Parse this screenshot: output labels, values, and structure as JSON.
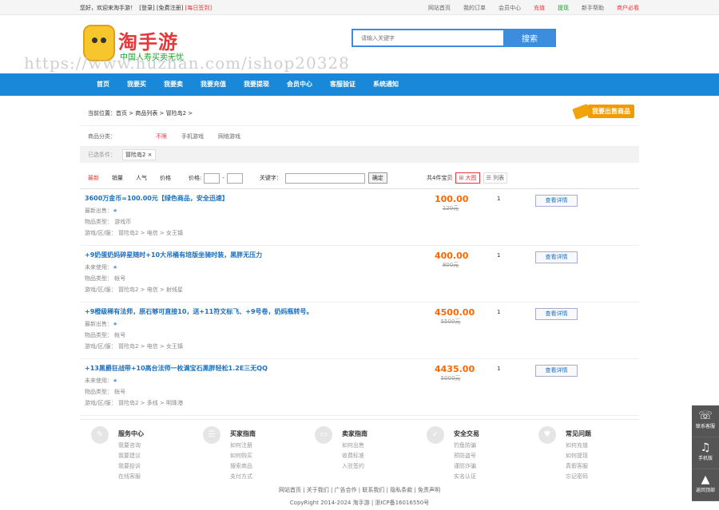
{
  "topbar": {
    "greeting": "您好，欢迎来淘手游！",
    "login": "[登录]",
    "register": "[免费注册]",
    "checkin": "[每日签到]",
    "links": [
      {
        "label": "网站首页",
        "color": "#666"
      },
      {
        "label": "我的订单",
        "color": "#666"
      },
      {
        "label": "会员中心",
        "color": "#666"
      },
      {
        "label": "充值",
        "color": "#e4393c"
      },
      {
        "label": "提现",
        "color": "#1a9f29"
      },
      {
        "label": "新手帮助",
        "color": "#666"
      },
      {
        "label": "商户必看",
        "color": "#e4393c"
      }
    ]
  },
  "logo": {
    "title": "淘手游",
    "sub": "中国人寿买卖无忧"
  },
  "search": {
    "placeholder": "请输入关键字",
    "button": "搜索"
  },
  "watermark": "https://www.huzhan.com/ishop20328",
  "nav": [
    "首页",
    "我要买",
    "我要卖",
    "我要充值",
    "我要提现",
    "会员中心",
    "客服验证",
    "系统通知"
  ],
  "crumb": {
    "text": "当前位置：首页 > 商品列表 > 冒险岛2 >",
    "sell": "我要出售商品"
  },
  "cats": {
    "label": "商品分类：",
    "items": [
      "不限",
      "手机游戏",
      "网络游戏"
    ]
  },
  "filter": {
    "label": "已选条件：",
    "tag": "冒险岛2 ×"
  },
  "sort": {
    "items": [
      "最新",
      "销量",
      "人气",
      "价格"
    ],
    "price_label": "价格:",
    "dash": "-",
    "kw_label": "关键字：",
    "ok": "确定",
    "pages": "共4件宝贝",
    "mode_big": "⊞ 大图",
    "mode_list": "☰ 列表"
  },
  "items": [
    {
      "title": "3600万金币=100.00元【绿色商品，安全迅速】",
      "r1": "最新出售：",
      "r2": "物品类型：   游戏币",
      "r3": "游戏/区/服：  冒险岛2 > 电信 > 女王镇",
      "price": "100.00",
      "old": "120元",
      "qty": "1",
      "btn": "查看详情"
    },
    {
      "title": "+9奶蛋奶妈碎星随时+10大吊桶有培版坐骑时装，黑胖无压力",
      "r1": "未来使用：",
      "r2": "物品类型：   帐号",
      "r3": "游戏/区/服：  冒险岛2 > 电信 > 射线星",
      "price": "400.00",
      "old": "800元",
      "qty": "1",
      "btn": "查看详情"
    },
    {
      "title": "+9橙级稀有法师，原石够可直接10，送+11符文标飞、+9号卷，奶妈瓶转号。",
      "r1": "最新出售：",
      "r2": "物品类型：   帐号",
      "r3": "游戏/区/服：  冒险岛2 > 电信 > 女王镇",
      "price": "4500.00",
      "old": "5500元",
      "qty": "1",
      "btn": "查看详情"
    },
    {
      "title": "+13黑爵狂战带+10高台法师一枚满宝石黑胖轻松1.2E三无QQ",
      "r1": "未来使用：",
      "r2": "物品类型：   帐号",
      "r3": "游戏/区/服：  冒险岛2 > 多线 > 明珠港",
      "price": "4435.00",
      "old": "5000元",
      "qty": "1",
      "btn": "查看详情"
    }
  ],
  "services": [
    {
      "icon": "✎",
      "title": "服务中心",
      "links": [
        "我要咨询",
        "我要建议",
        "我要投诉",
        "在线客服"
      ]
    },
    {
      "icon": "☰",
      "title": "买家指南",
      "links": [
        "如何注册",
        "如何购买",
        "搜索商品",
        "支付方式"
      ]
    },
    {
      "icon": "▭",
      "title": "卖家指南",
      "links": [
        "如何出售",
        "收费标准",
        "入驻签约"
      ]
    },
    {
      "icon": "✓",
      "title": "安全交易",
      "links": [
        "钓鱼防骗",
        "预防盗号",
        "谨防诈骗",
        "实名认证"
      ]
    },
    {
      "icon": "♥",
      "title": "常见问题",
      "links": [
        "如何充值",
        "如何提现",
        "真假客服",
        "忘记密码"
      ]
    }
  ],
  "footer": {
    "links": "网站首页 | 关于我们 | 广告合作 | 联系我们 | 隐私条款 | 免责声明",
    "copy": "CopyRight 2014-2024 淘手游 | 浙ICP备16016550号"
  },
  "side": [
    {
      "icon": "☏",
      "label": "联系客服"
    },
    {
      "icon": "♫",
      "label": "手机版"
    },
    {
      "icon": "▲",
      "label": "返回顶部"
    }
  ]
}
